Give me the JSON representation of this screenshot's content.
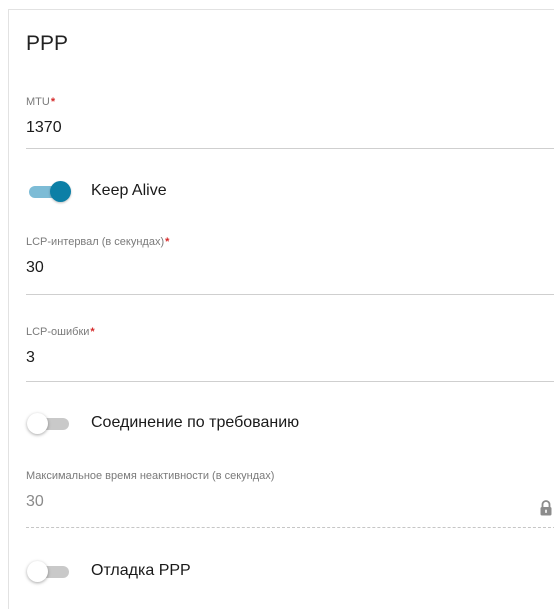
{
  "section": {
    "title": "PPP"
  },
  "mtu": {
    "label": "MTU",
    "required_mark": "*",
    "value": "1370"
  },
  "keep_alive": {
    "label": "Keep Alive",
    "enabled": true
  },
  "lcp_interval": {
    "label": "LCP-интервал (в секундах)",
    "required_mark": "*",
    "value": "30"
  },
  "lcp_errors": {
    "label": "LCP-ошибки",
    "required_mark": "*",
    "value": "3"
  },
  "on_demand": {
    "label": "Соединение по требованию",
    "enabled": false
  },
  "idle_time": {
    "label": "Максимальное время неактивности (в секундах)",
    "value": "30",
    "icon": "lock-icon",
    "disabled": true
  },
  "ppp_debug": {
    "label": "Отладка PPP",
    "enabled": false
  },
  "colors": {
    "accent": "#0c7fa6",
    "required": "#d52b2b"
  }
}
